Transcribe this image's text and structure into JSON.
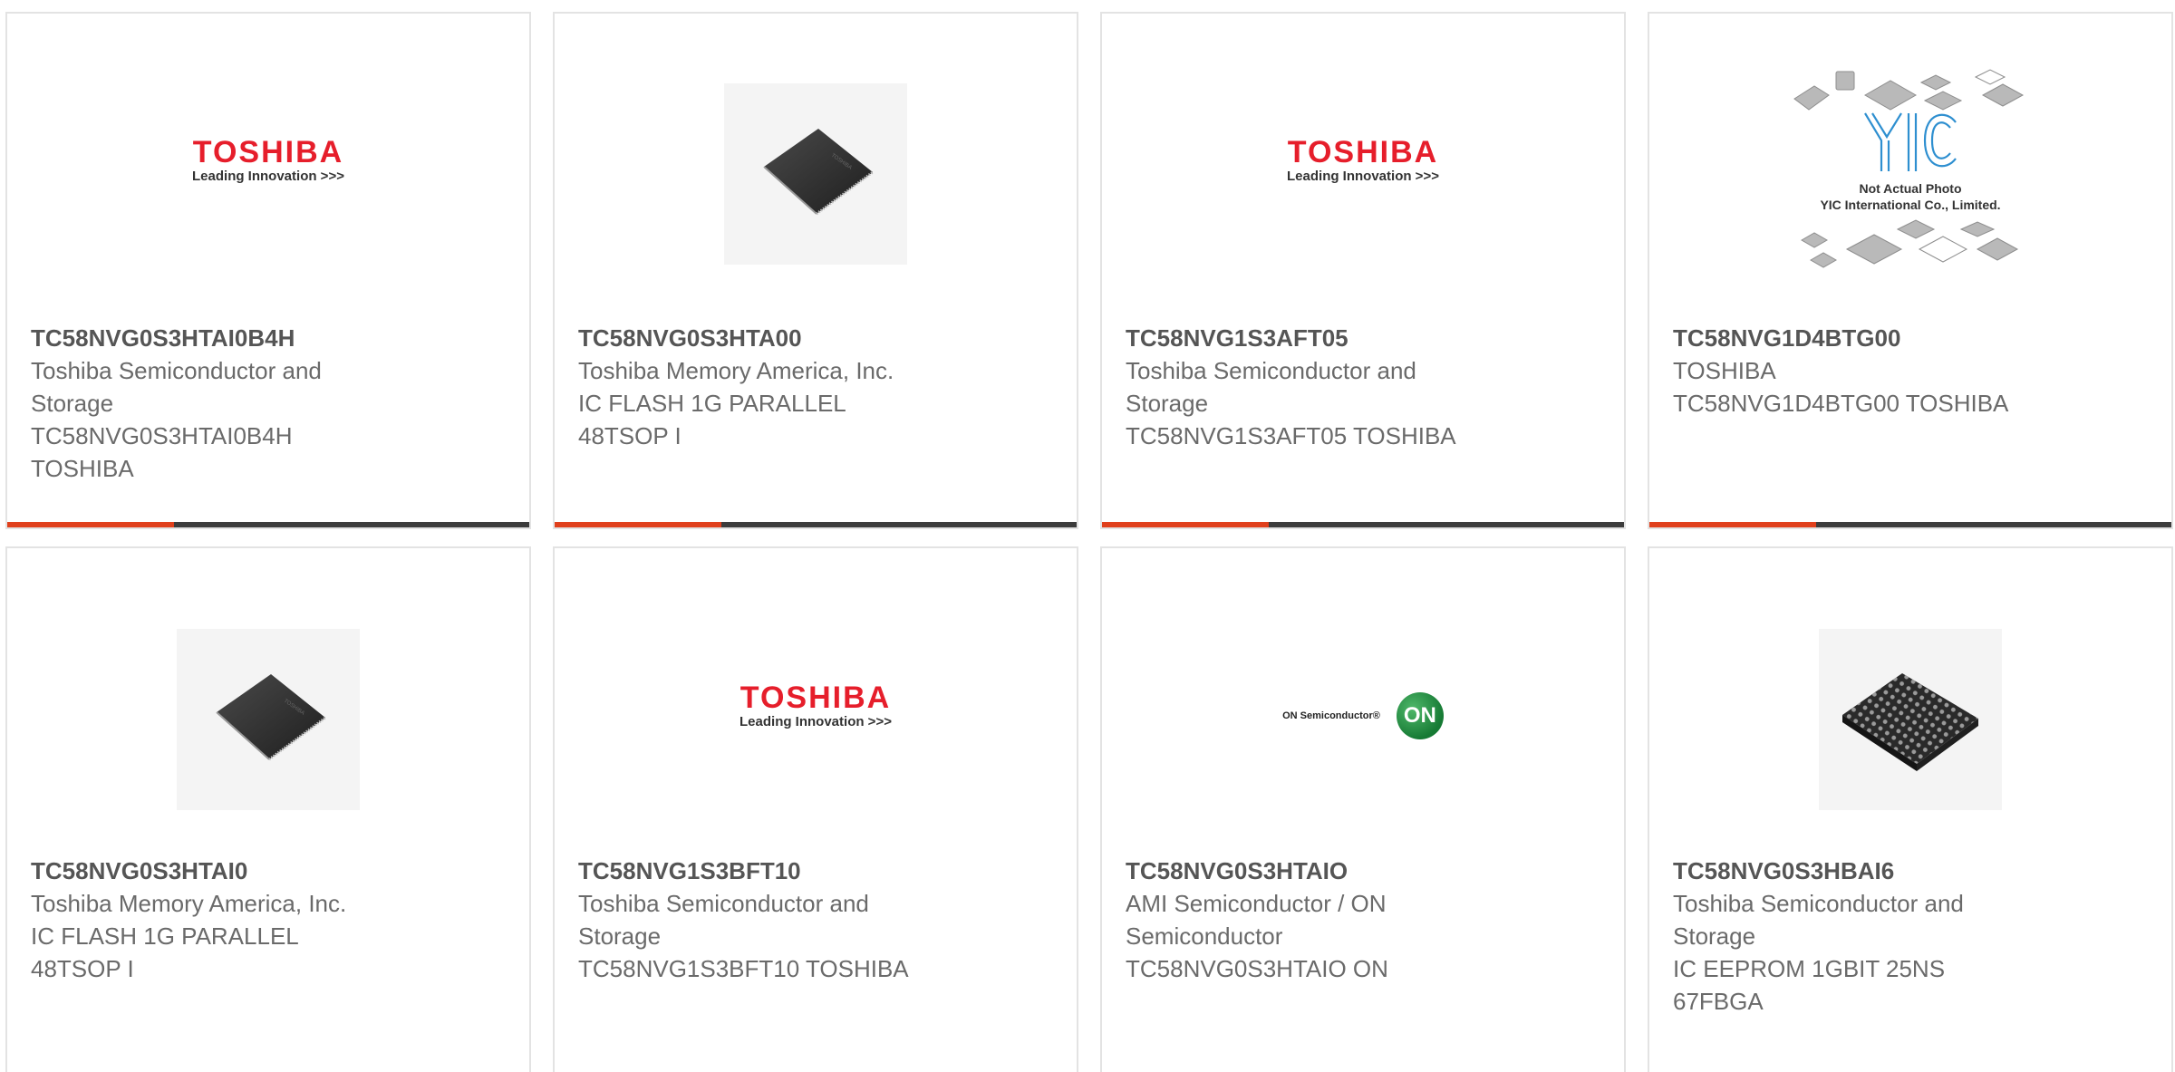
{
  "products": [
    {
      "part_number": "TC58NVG0S3HTAI0B4H",
      "lines": [
        "Toshiba Semiconductor and",
        "Storage",
        "TC58NVG0S3HTAI0B4H",
        "TOSHIBA"
      ],
      "image": "toshiba-logo"
    },
    {
      "part_number": "TC58NVG0S3HTA00",
      "lines": [
        "Toshiba Memory America, Inc.",
        "IC FLASH 1G PARALLEL",
        "48TSOP I"
      ],
      "image": "tsop-chip-photo"
    },
    {
      "part_number": "TC58NVG1S3AFT05",
      "lines": [
        "Toshiba Semiconductor and",
        "Storage",
        "TC58NVG1S3AFT05 TOSHIBA"
      ],
      "image": "toshiba-logo"
    },
    {
      "part_number": "TC58NVG1D4BTG00",
      "lines": [
        "TOSHIBA",
        "TC58NVG1D4BTG00 TOSHIBA"
      ],
      "image": "yic-placeholder"
    },
    {
      "part_number": "TC58NVG0S3HTAI0",
      "lines": [
        "Toshiba Memory America, Inc.",
        "IC FLASH 1G PARALLEL",
        "48TSOP I"
      ],
      "image": "tsop-chip-photo"
    },
    {
      "part_number": "TC58NVG1S3BFT10",
      "lines": [
        "Toshiba Semiconductor and",
        "Storage",
        "TC58NVG1S3BFT10 TOSHIBA"
      ],
      "image": "toshiba-logo"
    },
    {
      "part_number": "TC58NVG0S3HTAIO",
      "lines": [
        "AMI Semiconductor / ON",
        "Semiconductor",
        "TC58NVG0S3HTAIO ON"
      ],
      "image": "on-semiconductor-logo"
    },
    {
      "part_number": "TC58NVG0S3HBAI6",
      "lines": [
        "Toshiba Semiconductor and",
        "Storage",
        "IC EEPROM 1GBIT 25NS",
        "67FBGA"
      ],
      "image": "bga-chip-photo"
    }
  ],
  "logos": {
    "toshiba_word": "TOSHIBA",
    "toshiba_tagline": "Leading Innovation >>>",
    "onsemi_text": "ON Semiconductor®",
    "onsemi_badge": "ON",
    "yic_caption1": "Not Actual Photo",
    "yic_caption2": "YIC International Co., Limited."
  },
  "colors": {
    "accent": "#e0401c",
    "bar": "#3c3c3c",
    "toshiba_red": "#e61e2b",
    "card_border": "#e3e3e3",
    "part_text": "#555555",
    "desc_text": "#6a6a6a"
  }
}
